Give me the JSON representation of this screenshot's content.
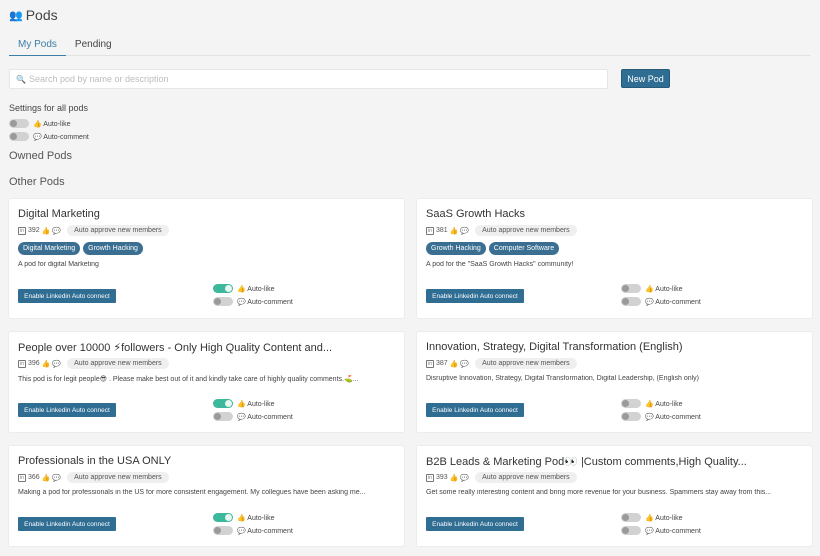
{
  "header": {
    "icon": "👥",
    "title": "Pods"
  },
  "tabs": [
    {
      "label": "My Pods",
      "active": true
    },
    {
      "label": "Pending",
      "active": false
    }
  ],
  "search": {
    "placeholder": "Search pod by name or description",
    "value": ""
  },
  "new_pod_label": "New Pod",
  "settings": {
    "title": "Settings for all pods",
    "auto_like": {
      "label": "👍 Auto-like",
      "on": false
    },
    "auto_comment": {
      "label": "💬 Auto-comment",
      "on": false
    }
  },
  "owned_heading": "Owned Pods",
  "other_heading": "Other Pods",
  "pods": [
    {
      "title": "Digital Marketing",
      "members": "392",
      "approve": "Auto approve new members",
      "tags": [
        "Digital Marketing",
        "Growth Hacking"
      ],
      "description": "A pod for digital Marketing",
      "enable_label": "Enable Linkedin Auto connect",
      "auto_like": {
        "label": "👍 Auto-like",
        "on": true
      },
      "auto_comment": {
        "label": "💬 Auto-comment",
        "on": false
      }
    },
    {
      "title": "SaaS Growth Hacks",
      "members": "381",
      "approve": "Auto approve new members",
      "tags": [
        "Growth Hacking",
        "Computer Software"
      ],
      "description": "A pod for the \"SaaS Growth Hacks\" community!",
      "enable_label": "Enable Linkedin Auto connect",
      "auto_like": {
        "label": "👍 Auto-like",
        "on": false
      },
      "auto_comment": {
        "label": "💬 Auto-comment",
        "on": false
      }
    },
    {
      "title": "People over 10000 ⚡followers - Only High Quality Content and...",
      "members": "396",
      "approve": "Auto approve new members",
      "tags": [],
      "description": "This pod is for legit people😎 . Please make best out of it and kindly take care of highly quality comments.⛳...",
      "enable_label": "Enable Linkedin Auto connect",
      "auto_like": {
        "label": "👍 Auto-like",
        "on": true
      },
      "auto_comment": {
        "label": "💬 Auto-comment",
        "on": false
      }
    },
    {
      "title": "Innovation, Strategy, Digital Transformation (English)",
      "members": "387",
      "approve": "Auto approve new members",
      "tags": [],
      "description": "Disruptive Innovation, Strategy, Digital Transformation, Digital Leadership, (English only)",
      "enable_label": "Enable Linkedin Auto connect",
      "auto_like": {
        "label": "👍 Auto-like",
        "on": false
      },
      "auto_comment": {
        "label": "💬 Auto-comment",
        "on": false
      }
    },
    {
      "title": "Professionals in the USA ONLY",
      "members": "366",
      "approve": "Auto approve new members",
      "tags": [],
      "description": "Making a pod for professionals in the US for more consistent engagement. My collegues have been asking me...",
      "enable_label": "Enable Linkedin Auto connect",
      "auto_like": {
        "label": "👍 Auto-like",
        "on": true
      },
      "auto_comment": {
        "label": "💬 Auto-comment",
        "on": false
      }
    },
    {
      "title": "B2B Leads & Marketing Pod👀 |Custom comments,High Quality...",
      "members": "393",
      "approve": "Auto approve new members",
      "tags": [],
      "description": "Get some really interesting content and bring more revenue for your business. Spammers stay away from this...",
      "enable_label": "Enable Linkedin Auto connect",
      "auto_like": {
        "label": "👍 Auto-like",
        "on": false
      },
      "auto_comment": {
        "label": "💬 Auto-comment",
        "on": false
      }
    }
  ]
}
